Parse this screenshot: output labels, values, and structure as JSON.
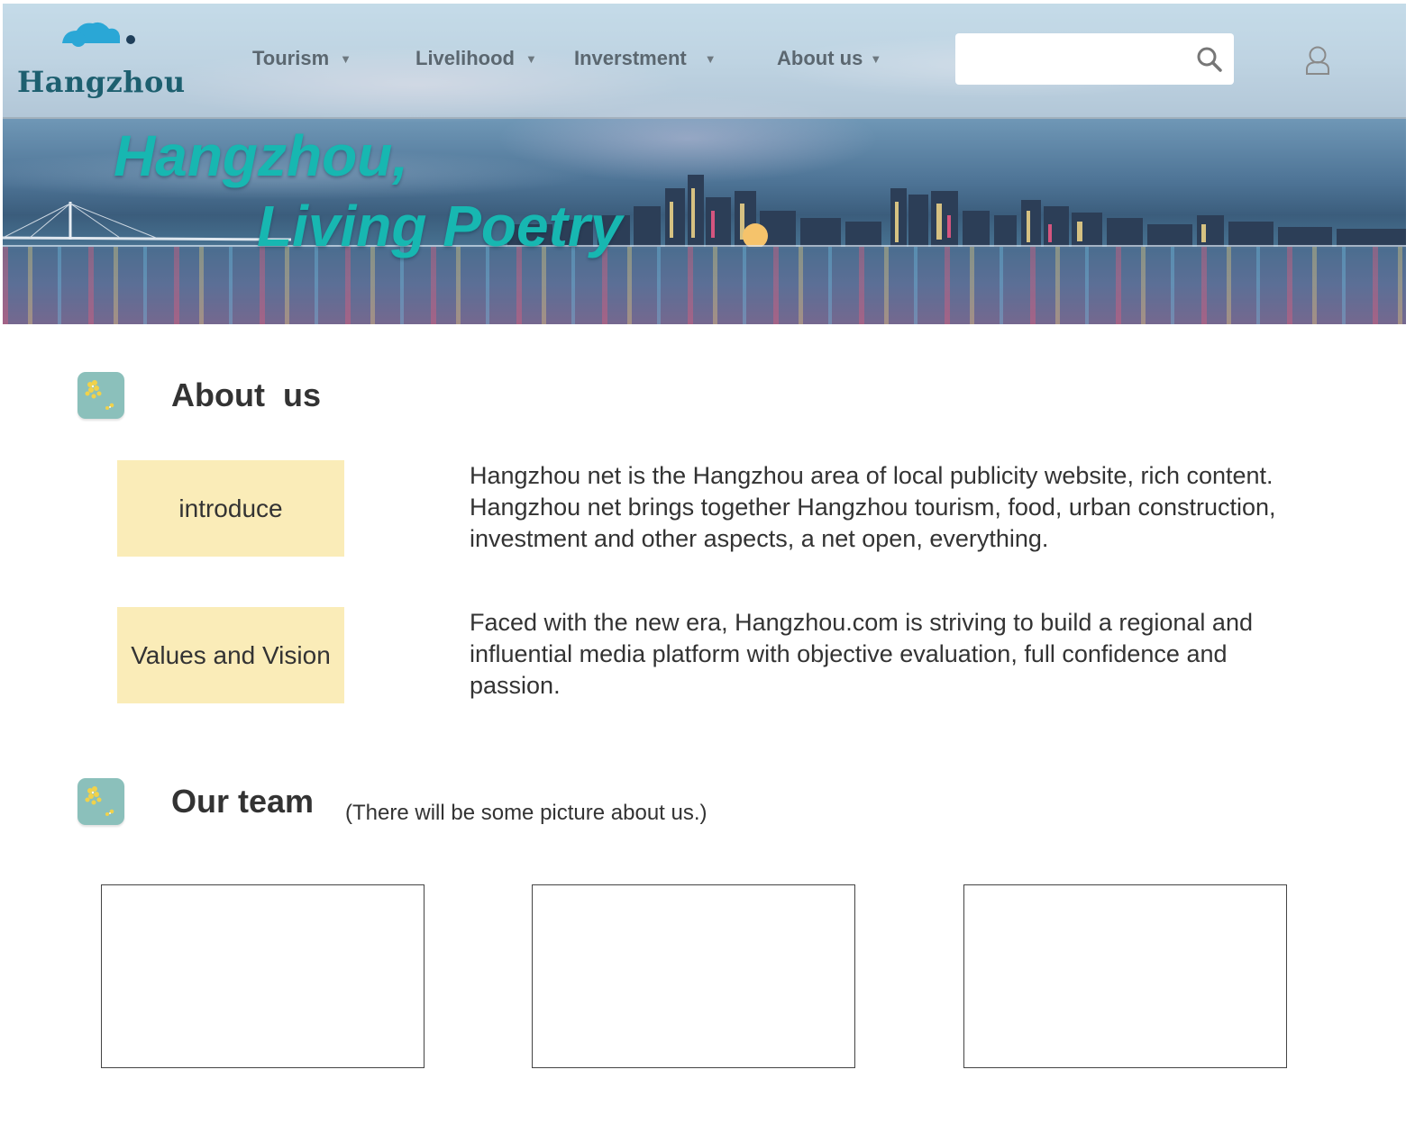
{
  "header": {
    "logo_text": "Hangzhou",
    "nav": [
      {
        "label": "Tourism"
      },
      {
        "label": "Livelihood"
      },
      {
        "label": "Inverstment"
      },
      {
        "label": "About us"
      }
    ],
    "search": {
      "placeholder": "",
      "value": "",
      "icon": "search-icon"
    },
    "user_icon": "user-icon"
  },
  "hero": {
    "line1": "Hangzhou,",
    "line2": "Living Poetry",
    "title_color": "#17b7b1"
  },
  "about": {
    "title": "About  us",
    "icon": "flower-icon",
    "items": [
      {
        "label": "introduce",
        "text": "Hangzhou net is the Hangzhou area of local publicity website, rich content.\n Hangzhou net brings together Hangzhou tourism, food, urban construction,\ninvestment and other aspects, a net open, everything."
      },
      {
        "label": "Values and Vision",
        "text": "Faced with the new era, Hangzhou.com is striving to build a regional and\ninfluential media platform with objective evaluation, full confidence and\npassion."
      }
    ]
  },
  "team": {
    "title": "Our team",
    "note": "(There will be some picture about us.)",
    "icon": "flower-icon",
    "photo_count": 3
  },
  "colors": {
    "accent_teal": "#17b7b1",
    "tag_background": "#faecb8",
    "section_icon_background": "#8bc0bb",
    "logo_text": "#1d5f6f"
  }
}
